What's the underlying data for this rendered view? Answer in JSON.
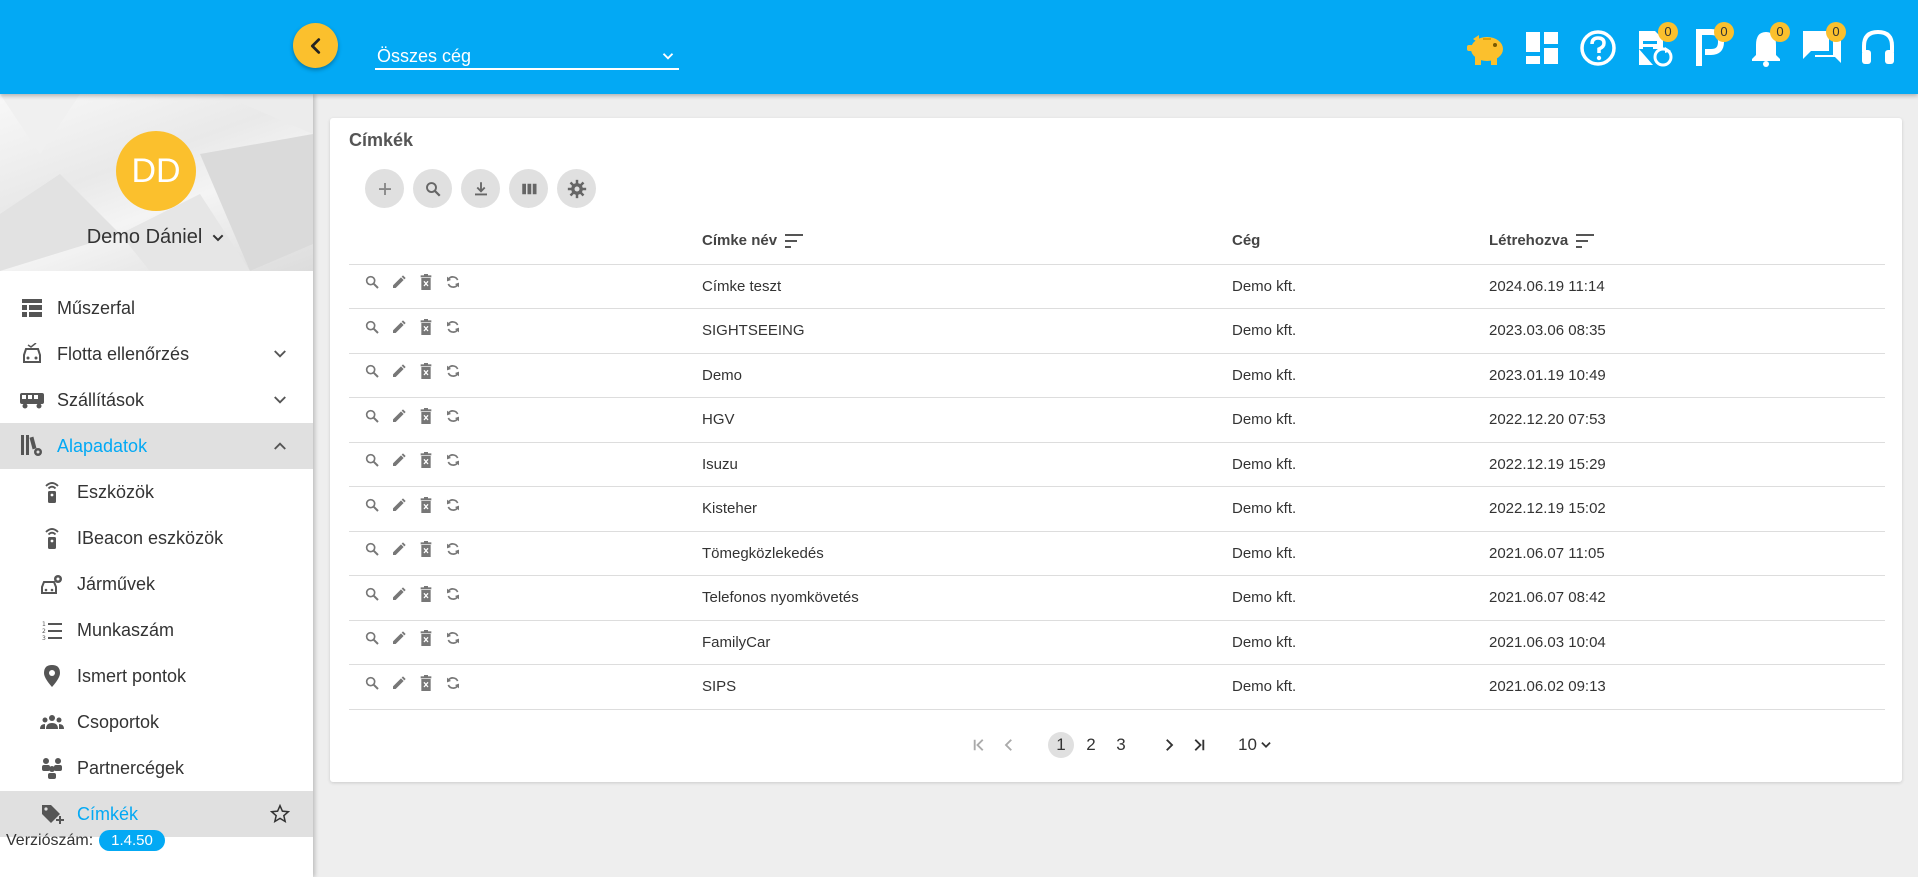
{
  "header": {
    "company_select": "Összes cég",
    "badges": {
      "docs": "0",
      "parking": "0",
      "notifications": "0",
      "messages": "0"
    }
  },
  "profile": {
    "initials": "DD",
    "name": "Demo Dániel"
  },
  "sidebar": {
    "items": [
      {
        "label": "Műszerfal",
        "icon": "dashboard-table-icon"
      },
      {
        "label": "Flotta ellenőrzés",
        "icon": "car-check-icon"
      },
      {
        "label": "Szállítások",
        "icon": "bus-icon"
      },
      {
        "label": "Alapadatok",
        "icon": "base-data-icon"
      },
      {
        "label": "Eszközök",
        "icon": "remote-device-icon"
      },
      {
        "label": "IBeacon eszközök",
        "icon": "beacon-device-icon"
      },
      {
        "label": "Járművek",
        "icon": "car-gear-icon"
      },
      {
        "label": "Munkaszám",
        "icon": "numbered-list-icon"
      },
      {
        "label": "Ismert pontok",
        "icon": "map-pin-icon"
      },
      {
        "label": "Csoportok",
        "icon": "group-icon"
      },
      {
        "label": "Partnercégek",
        "icon": "partner-companies-icon"
      },
      {
        "label": "Címkék",
        "icon": "tag-add-icon"
      }
    ],
    "version_label": "Verziószám:",
    "version": "1.4.50"
  },
  "main": {
    "title": "Címkék",
    "columns": {
      "name": "Címke név",
      "company": "Cég",
      "created": "Létrehozva"
    },
    "rows": [
      {
        "name": "Címke teszt",
        "company": "Demo kft.",
        "created": "2024.06.19 11:14"
      },
      {
        "name": "SIGHTSEEING",
        "company": "Demo kft.",
        "created": "2023.03.06 08:35"
      },
      {
        "name": "Demo",
        "company": "Demo kft.",
        "created": "2023.01.19 10:49"
      },
      {
        "name": "HGV",
        "company": "Demo kft.",
        "created": "2022.12.20 07:53"
      },
      {
        "name": "Isuzu",
        "company": "Demo kft.",
        "created": "2022.12.19 15:29"
      },
      {
        "name": "Kisteher",
        "company": "Demo kft.",
        "created": "2022.12.19 15:02"
      },
      {
        "name": "Tömegközlekedés",
        "company": "Demo kft.",
        "created": "2021.06.07 11:05"
      },
      {
        "name": "Telefonos nyomkövetés",
        "company": "Demo kft.",
        "created": "2021.06.07 08:42"
      },
      {
        "name": "FamilyCar",
        "company": "Demo kft.",
        "created": "2021.06.03 10:04"
      },
      {
        "name": "SIPS",
        "company": "Demo kft.",
        "created": "2021.06.02 09:13"
      }
    ],
    "pagination": {
      "pages": [
        "1",
        "2",
        "3"
      ],
      "current": "1",
      "page_size": "10"
    }
  },
  "colors": {
    "primary": "#03a9f4",
    "accent": "#fbc02d"
  }
}
